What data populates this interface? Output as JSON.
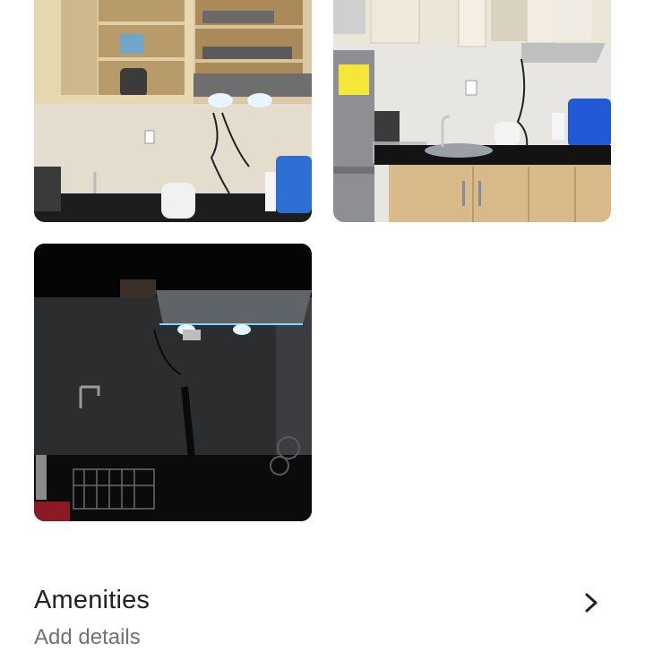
{
  "photos": [
    {
      "icon": "kitchen-cabinets-photo",
      "alt": ""
    },
    {
      "icon": "kitchen-counter-photo",
      "alt": ""
    },
    {
      "icon": "kitchen-dark-photo",
      "alt": ""
    }
  ],
  "amenities": {
    "title": "Amenities",
    "subtitle": "Add details",
    "chevron_icon": "chevron-right-icon"
  },
  "colors": {
    "title_text": "#222222",
    "subtitle_text": "#717171",
    "background": "#ffffff"
  }
}
